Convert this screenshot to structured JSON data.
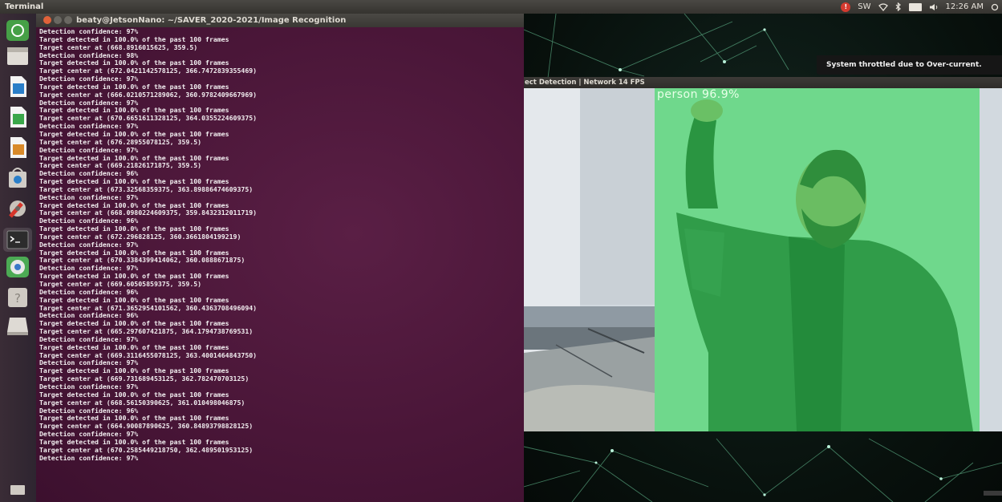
{
  "top_panel": {
    "app_name": "Terminal",
    "indicators": [
      "SW",
      "12:26 AM"
    ]
  },
  "launcher": {
    "items": [
      "dash-icon",
      "files-icon",
      "writer-icon",
      "calc-icon",
      "impress-icon",
      "software-icon",
      "settings-icon",
      "terminal-icon",
      "chromium-icon",
      "help-icon",
      "drive-icon"
    ]
  },
  "terminal": {
    "title": "beaty@JetsonNano: ~/SAVER_2020-2021/Image Recognition",
    "lines": [
      "Detection confidence: 97%",
      "Target detected in 100.0% of the past 100 frames",
      "Target center at (668.8916015625, 359.5)",
      "Detection confidence: 98%",
      "Target detected in 100.0% of the past 100 frames",
      "Target center at (672.0421142578125, 366.7472839355469)",
      "Detection confidence: 97%",
      "Target detected in 100.0% of the past 100 frames",
      "Target center at (666.0210571289062, 360.9782409667969)",
      "Detection confidence: 97%",
      "Target detected in 100.0% of the past 100 frames",
      "Target center at (670.6651611328125, 364.0355224609375)",
      "Detection confidence: 97%",
      "Target detected in 100.0% of the past 100 frames",
      "Target center at (676.28955078125, 359.5)",
      "Detection confidence: 97%",
      "Target detected in 100.0% of the past 100 frames",
      "Target center at (669.21826171875, 359.5)",
      "Detection confidence: 96%",
      "Target detected in 100.0% of the past 100 frames",
      "Target center at (673.32568359375, 363.89886474609375)",
      "Detection confidence: 97%",
      "Target detected in 100.0% of the past 100 frames",
      "Target center at (668.0980224609375, 359.8432312011719)",
      "Detection confidence: 96%",
      "Target detected in 100.0% of the past 100 frames",
      "Target center at (672.296828125, 360.3661804199219)",
      "Detection confidence: 97%",
      "Target detected in 100.0% of the past 100 frames",
      "Target center at (670.3384399414062, 360.0888671875)",
      "Detection confidence: 97%",
      "Target detected in 100.0% of the past 100 frames",
      "Target center at (669.60505859375, 359.5)",
      "Detection confidence: 96%",
      "Target detected in 100.0% of the past 100 frames",
      "Target center at (671.3652954101562, 360.4363708496094)",
      "Detection confidence: 96%",
      "Target detected in 100.0% of the past 100 frames",
      "Target center at (665.297607421875, 364.1794738769531)",
      "Detection confidence: 97%",
      "Target detected in 100.0% of the past 100 frames",
      "Target center at (669.3116455078125, 363.4001464843750)",
      "Detection confidence: 97%",
      "Target detected in 100.0% of the past 100 frames",
      "Target center at (669.731689453125, 362.782470703125)",
      "Detection confidence: 97%",
      "Target detected in 100.0% of the past 100 frames",
      "Target center at (668.56150390625, 361.010498046875)",
      "Detection confidence: 96%",
      "Target detected in 100.0% of the past 100 frames",
      "Target center at (664.90087890625, 360.84893798828125)",
      "Detection confidence: 97%",
      "Target detected in 100.0% of the past 100 frames",
      "Target center at (670.2585449218750, 362.489501953125)",
      "Detection confidence: 97%"
    ]
  },
  "notification": {
    "text": "System throttled due to Over-current."
  },
  "detection_window": {
    "title": "ect Detection | Network 14 FPS",
    "label": "person 96.9%"
  },
  "colors": {
    "terminal_bg": "#4a1638",
    "bbox": "#28d750",
    "panel": "#3c3b37"
  }
}
